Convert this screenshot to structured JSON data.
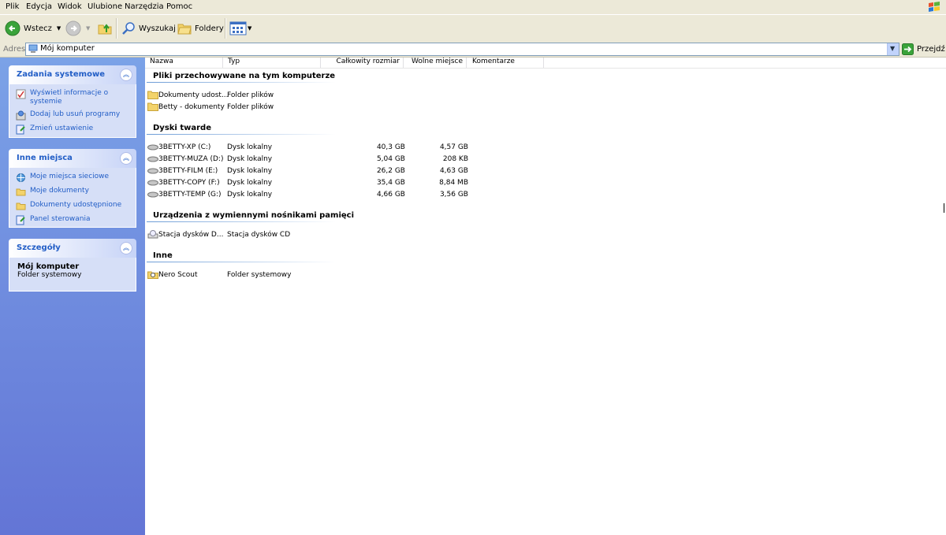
{
  "menubar": {
    "items": [
      "Plik",
      "Edycja",
      "Widok",
      "Ulubione",
      "Narzędzia",
      "Pomoc"
    ]
  },
  "toolbar": {
    "back_label": "Wstecz",
    "search_label": "Wyszukaj",
    "folders_label": "Foldery"
  },
  "address": {
    "label": "Adres",
    "value": "Mój komputer",
    "go_label": "Przejdź"
  },
  "left": {
    "system_tasks": {
      "title": "Zadania systemowe",
      "items": [
        "Wyświetl informacje o systemie",
        "Dodaj lub usuń programy",
        "Zmień ustawienie"
      ]
    },
    "other_places": {
      "title": "Inne miejsca",
      "items": [
        "Moje miejsca sieciowe",
        "Moje dokumenty",
        "Dokumenty udostępnione",
        "Panel sterowania"
      ]
    },
    "details": {
      "title": "Szczegóły",
      "name": "Mój komputer",
      "type": "Folder systemowy"
    }
  },
  "columns": [
    "Nazwa",
    "Typ",
    "Całkowity rozmiar",
    "Wolne miejsce",
    "Komentarze"
  ],
  "groups": {
    "stored": {
      "title": "Pliki przechowywane na tym komputerze",
      "items": [
        {
          "name": "Dokumenty udost...",
          "type": "Folder plików"
        },
        {
          "name": "Betty - dokumenty",
          "type": "Folder plików"
        }
      ]
    },
    "drives": {
      "title": "Dyski twarde",
      "items": [
        {
          "name": "3BETTY-XP (C:)",
          "type": "Dysk lokalny",
          "total": "40,3 GB",
          "free": "4,57 GB"
        },
        {
          "name": "3BETTY-MUZA (D:)",
          "type": "Dysk lokalny",
          "total": "5,04 GB",
          "free": "208 KB"
        },
        {
          "name": "3BETTY-FILM (E:)",
          "type": "Dysk lokalny",
          "total": "26,2 GB",
          "free": "4,63 GB"
        },
        {
          "name": "3BETTY-COPY (F:)",
          "type": "Dysk lokalny",
          "total": "35,4 GB",
          "free": "8,84 MB"
        },
        {
          "name": "3BETTY-TEMP (G:)",
          "type": "Dysk lokalny",
          "total": "4,66 GB",
          "free": "3,56 GB"
        }
      ]
    },
    "removable": {
      "title": "Urządzenia z wymiennymi nośnikami pamięci",
      "items": [
        {
          "name": "Stacja dysków D...",
          "type": "Stacja dysków CD"
        }
      ]
    },
    "other": {
      "title": "Inne",
      "items": [
        {
          "name": "Nero Scout",
          "type": "Folder systemowy"
        }
      ]
    }
  }
}
